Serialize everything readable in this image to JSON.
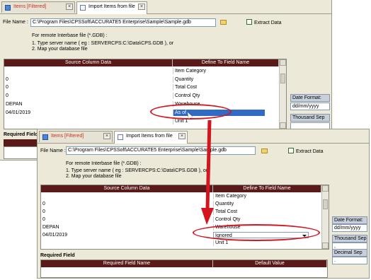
{
  "back": {
    "tabs": [
      {
        "label": "Items [Filtered]",
        "filtered": true
      },
      {
        "label": "Import Items from file",
        "filtered": false
      }
    ],
    "file_name_label": "File Name :",
    "file_path": "C:\\Program Files\\CPSSoft\\ACCURATE5 Enterprise\\Sample\\Sample.gdb",
    "extract_label": "Extract Data",
    "notes": [
      "For remote Interbase file (*.GDB) :",
      "1. Type server name ( eg : SERVERCPS:C:\\Data\\CPS.GDB ), or",
      "2. Map your database file"
    ],
    "grid_headers": [
      "Source Column Data",
      "Define To Field Name"
    ],
    "rows": [
      {
        "src": "",
        "dst": "Item Category"
      },
      {
        "src": "0",
        "dst": "Quantity"
      },
      {
        "src": "0",
        "dst": "Total Cost"
      },
      {
        "src": "0",
        "dst": "Control Qty"
      },
      {
        "src": "DEPAN",
        "dst": "Warehouse"
      },
      {
        "src": "04/01/2019",
        "dst": "As of"
      },
      {
        "src": "",
        "dst": "Unit 1"
      }
    ],
    "date_format_label": "Date Format:",
    "date_format_value": "dd/mm/yyyy",
    "thousand_sep_label": "Thousand Sep",
    "required_field_label": "Required Field"
  },
  "front": {
    "tabs": [
      {
        "label": "Items [Filtered]",
        "filtered": true
      },
      {
        "label": "Import Items from file",
        "filtered": false
      }
    ],
    "file_name_label": "File Name :",
    "file_path": "C:\\Program Files\\CPSSoft\\ACCURATE5 Enterprise\\Sample\\Sample.gdb",
    "extract_label": "Extract Data",
    "notes": [
      "For remote Interbase file (*.GDB) :",
      "1. Type server name ( eg : SERVERCPS:C:\\Data\\CPS.GDB ), or",
      "2. Map your database file"
    ],
    "grid_headers": [
      "Source Column Data",
      "Define To Field Name"
    ],
    "rows": [
      {
        "src": "",
        "dst": "Item Category"
      },
      {
        "src": "0",
        "dst": "Quantity"
      },
      {
        "src": "0",
        "dst": "Total Cost"
      },
      {
        "src": "0",
        "dst": "Control Qty"
      },
      {
        "src": "DEPAN",
        "dst": "Warehouse"
      },
      {
        "src": "04/01/2019",
        "dst": "Ignored"
      },
      {
        "src": "",
        "dst": "Unit 1"
      }
    ],
    "date_format_label": "Date Format:",
    "date_format_value": "dd/mm/yyyy",
    "thousand_sep_label": "Thousand Sep",
    "thousand_sep_value": ",",
    "decimal_sep_label": "Decimal Sep",
    "decimal_sep_value": ".",
    "required_field_label": "Required Field",
    "required_headers": [
      "Required Field Name",
      "Default Value"
    ]
  },
  "colors": {
    "annotation_red": "#d4141e",
    "header_bg": "#5a1a1a",
    "selection_blue": "#316ac5",
    "filtered_tab_text": "#c8321e"
  },
  "icons": [
    "grid-icon",
    "document-icon",
    "close-icon",
    "folder-icon",
    "extract-icon",
    "dropdown-arrow-icon",
    "mouse-cursor-icon"
  ]
}
